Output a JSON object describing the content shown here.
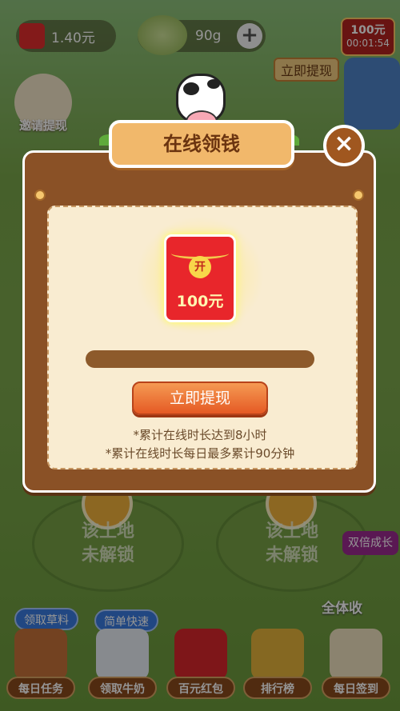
{
  "hud": {
    "cash": "1.40元",
    "grain": "90g",
    "plus_label": "+",
    "timer_amount": "100元",
    "timer_countdown": "00:01:54",
    "shop_button": "立即提现",
    "invite_label": "邀请提现"
  },
  "modal": {
    "title": "在线领钱",
    "close": "×",
    "packet_open": "开",
    "packet_amount": "100元",
    "withdraw_button": "立即提现",
    "note_1": "*累计在线时长达到8小时",
    "note_2": "*累计在线时长每日最多累计90分钟"
  },
  "fields": {
    "left_text": "该土地\n未解锁",
    "right_text": "该土地\n未解锁"
  },
  "badges": {
    "collect_grass": "领取草料",
    "easy_fast": "简单快速",
    "double_growth": "双倍成长",
    "harvest_all": "全体收"
  },
  "toolbar": [
    {
      "label": "每日任务"
    },
    {
      "label": "领取牛奶"
    },
    {
      "label": "百元红包"
    },
    {
      "label": "排行榜"
    },
    {
      "label": "每日签到"
    }
  ],
  "colors": {
    "modal_frame": "#8a5126",
    "modal_panel": "#f9ecd1",
    "packet_red": "#e8262b",
    "withdraw_orange": "#e55a24"
  }
}
